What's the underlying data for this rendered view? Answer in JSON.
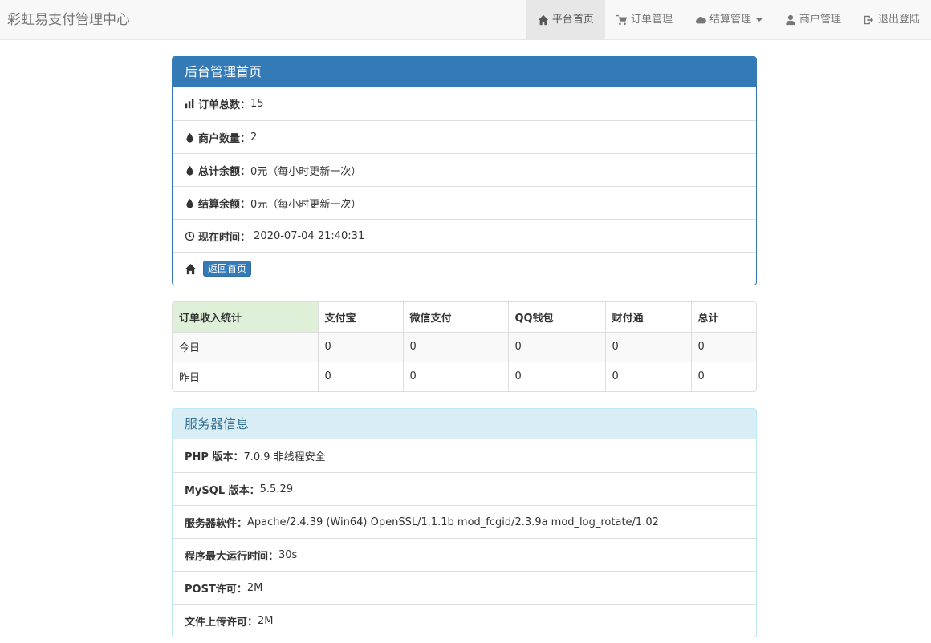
{
  "navbar": {
    "brand": "彩虹易支付管理中心",
    "items": [
      {
        "label": "平台首页",
        "icon": "home-icon",
        "active": true
      },
      {
        "label": "订单管理",
        "icon": "cart-icon"
      },
      {
        "label": "结算管理",
        "icon": "cloud-icon",
        "dropdown": true
      },
      {
        "label": "商户管理",
        "icon": "user-icon"
      },
      {
        "label": "退出登陆",
        "icon": "logout-icon"
      }
    ]
  },
  "admin_panel": {
    "title": "后台管理首页",
    "rows": [
      {
        "icon": "bar-chart-icon",
        "label": "订单总数：",
        "value": "15"
      },
      {
        "icon": "drop-icon",
        "label": "商户数量：",
        "value": "2"
      },
      {
        "icon": "drop-icon",
        "label": "总计余额：",
        "value": "0元（每小时更新一次）"
      },
      {
        "icon": "drop-icon",
        "label": "结算余额：",
        "value": "0元（每小时更新一次）"
      },
      {
        "icon": "clock-icon",
        "label": "现在时间：",
        "value": " 2020-07-04 21:40:31"
      }
    ],
    "home_button": "返回首页"
  },
  "stats_table": {
    "headers": [
      "订单收入统计",
      "支付宝",
      "微信支付",
      "QQ钱包",
      "财付通",
      "总计"
    ],
    "rows": [
      [
        "今日",
        "0",
        "0",
        "0",
        "0",
        "0"
      ],
      [
        "昨日",
        "0",
        "0",
        "0",
        "0",
        "0"
      ]
    ]
  },
  "server_panel": {
    "title": "服务器信息",
    "rows": [
      {
        "label": "PHP 版本：",
        "value": "7.0.9 非线程安全"
      },
      {
        "label": "MySQL 版本：",
        "value": "5.5.29"
      },
      {
        "label": "服务器软件：",
        "value": "Apache/2.4.39 (Win64) OpenSSL/1.1.1b mod_fcgid/2.3.9a mod_log_rotate/1.02"
      },
      {
        "label": "程序最大运行时间：",
        "value": "30s"
      },
      {
        "label": "POST许可：",
        "value": "2M"
      },
      {
        "label": "文件上传许可：",
        "value": "2M"
      }
    ]
  }
}
